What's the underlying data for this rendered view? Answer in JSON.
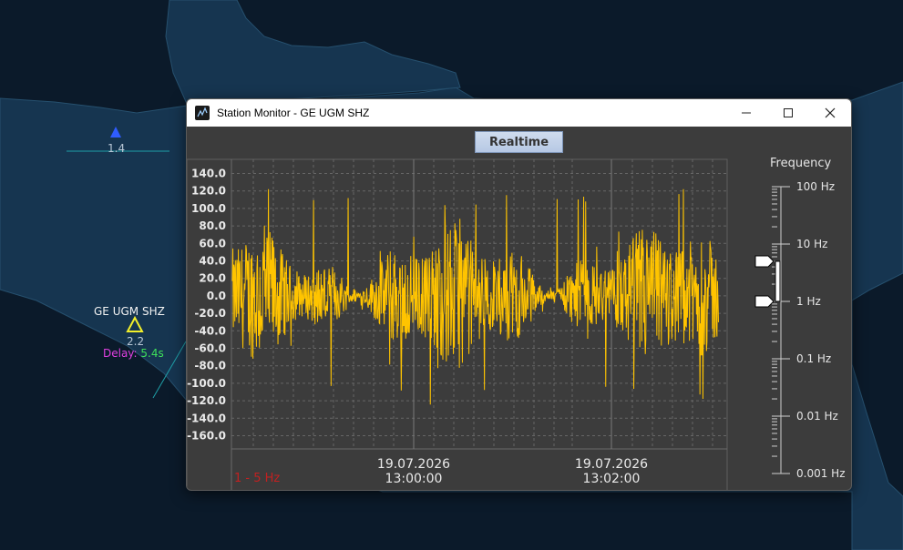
{
  "map": {
    "stations": [
      {
        "label": "",
        "value": "1.4",
        "color": "#2f5cff"
      },
      {
        "label": "GE UGM SHZ",
        "value": "2.2",
        "color": "#f2ef2a",
        "delay_label": "Delay:",
        "delay_value": "5.4s"
      }
    ]
  },
  "window": {
    "title": "Station Monitor - GE UGM SHZ",
    "realtime_label": "Realtime",
    "controls": {
      "minimize": "minimize-icon",
      "maximize": "maximize-icon",
      "close": "close-icon"
    }
  },
  "plot": {
    "filter_label": "1 - 5 Hz",
    "trace_color": "#ffc400",
    "y_ticks": [
      "140.0",
      "120.0",
      "100.0",
      "80.0",
      "60.0",
      "40.0",
      "20.0",
      "0.0",
      "-20.0",
      "-40.0",
      "-60.0",
      "-80.0",
      "-100.0",
      "-120.0",
      "-140.0",
      "-160.0"
    ],
    "x_ticks": [
      {
        "date": "19.07.2026",
        "time": "13:00:00"
      },
      {
        "date": "19.07.2026",
        "time": "13:02:00"
      }
    ]
  },
  "frequency": {
    "title": "Frequency",
    "labels": [
      "100 Hz",
      "10 Hz",
      "1 Hz",
      "0.1 Hz",
      "0.01 Hz",
      "0.001 Hz"
    ],
    "low_cut_hz": 1,
    "high_cut_hz": 5
  }
}
